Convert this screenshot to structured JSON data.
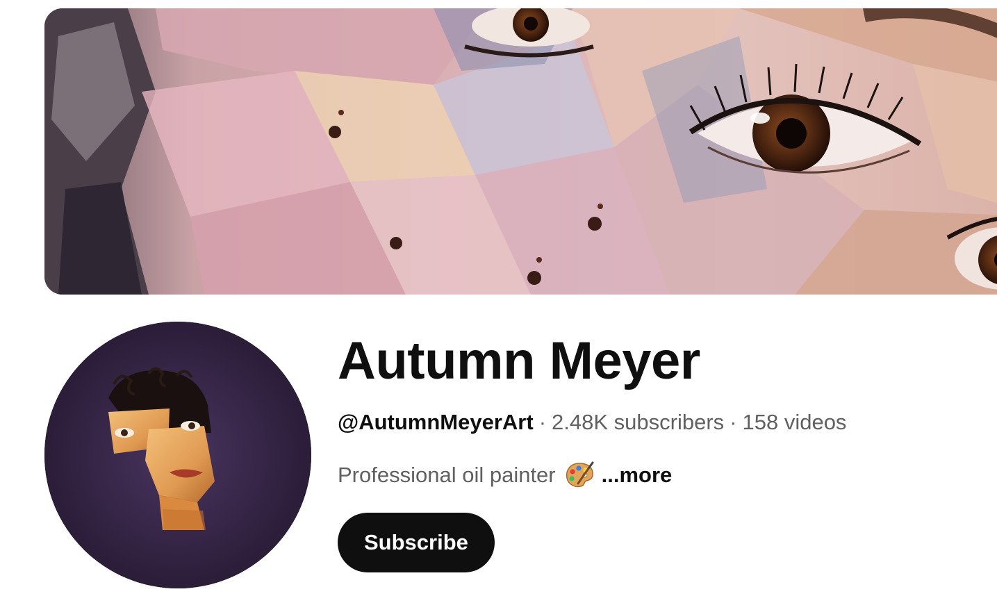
{
  "channel": {
    "name": "Autumn Meyer",
    "handle": "@AutumnMeyerArt",
    "separator": "·",
    "subscribers": "2.48K subscribers",
    "videos": "158 videos",
    "description": "Professional oil painter",
    "description_icon": "artist-palette-icon",
    "more_label": "...more",
    "subscribe_label": "Subscribe"
  },
  "colors": {
    "text_primary": "#0f0f0f",
    "text_secondary": "#606060",
    "button_bg": "#0f0f0f",
    "button_text": "#ffffff"
  }
}
